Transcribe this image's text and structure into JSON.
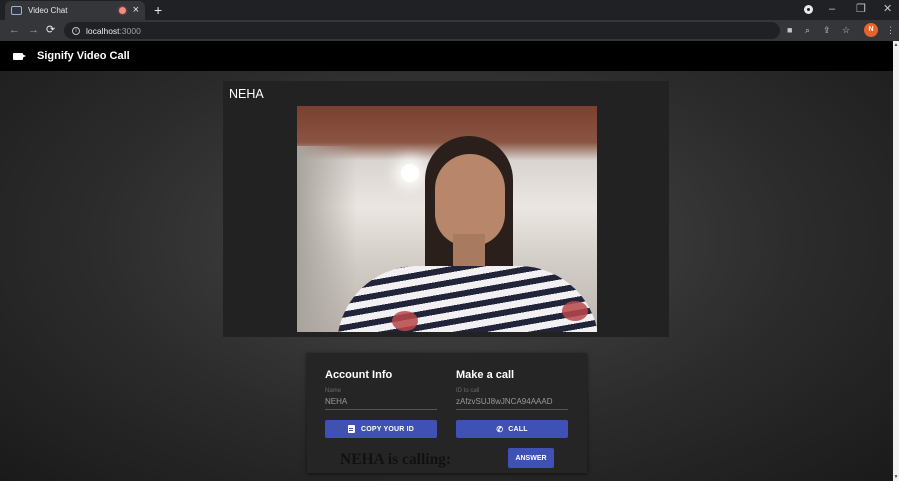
{
  "browser": {
    "tab_title": "Video Chat",
    "new_tab_symbol": "+",
    "url_host": "localhost",
    "url_port": ":3000",
    "profile_initial": "N",
    "window_controls": {
      "minimize": "–",
      "restore": "❐",
      "close": "✕"
    }
  },
  "app": {
    "title": "Signify Video Call",
    "video": {
      "name": "NEHA"
    },
    "account": {
      "title": "Account Info",
      "name_label": "Name",
      "name_value": "NEHA",
      "copy_button": "COPY YOUR ID"
    },
    "call": {
      "title": "Make a call",
      "id_label": "ID to call",
      "id_value": "zAfzvSUJ8wJNCA94AAAD",
      "call_button": "CALL"
    },
    "incoming": {
      "text": "NEHA is calling:",
      "answer_button": "ANSWER"
    }
  },
  "colors": {
    "accent": "#3f51b5",
    "appbar": "#000000",
    "panel": "#252525",
    "profile": "#e8622c"
  }
}
